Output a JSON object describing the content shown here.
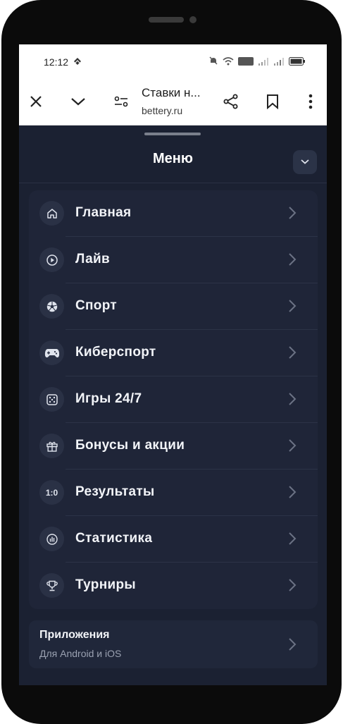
{
  "status_bar": {
    "time": "12:12"
  },
  "browser": {
    "page_title": "Ставки н...",
    "url": "bettery.ru"
  },
  "menu": {
    "title": "Меню",
    "items": [
      {
        "label": "Главная",
        "icon": "home-icon"
      },
      {
        "label": "Лайв",
        "icon": "play-icon"
      },
      {
        "label": "Спорт",
        "icon": "soccer-ball-icon"
      },
      {
        "label": "Киберспорт",
        "icon": "gamepad-icon"
      },
      {
        "label": "Игры 24/7",
        "icon": "dice-icon"
      },
      {
        "label": "Бонусы и акции",
        "icon": "gift-icon"
      },
      {
        "label": "Результаты",
        "icon": "score-icon",
        "icon_text": "1:0"
      },
      {
        "label": "Статистика",
        "icon": "stats-icon"
      },
      {
        "label": "Турниры",
        "icon": "trophy-icon"
      }
    ]
  },
  "apps": {
    "title": "Приложения",
    "subtitle": "Для Android и iOS"
  },
  "colors": {
    "sheet_bg": "#1b2132",
    "card_bg": "#1f2538",
    "text": "#f2f4f8",
    "muted": "#9aa1b1"
  }
}
